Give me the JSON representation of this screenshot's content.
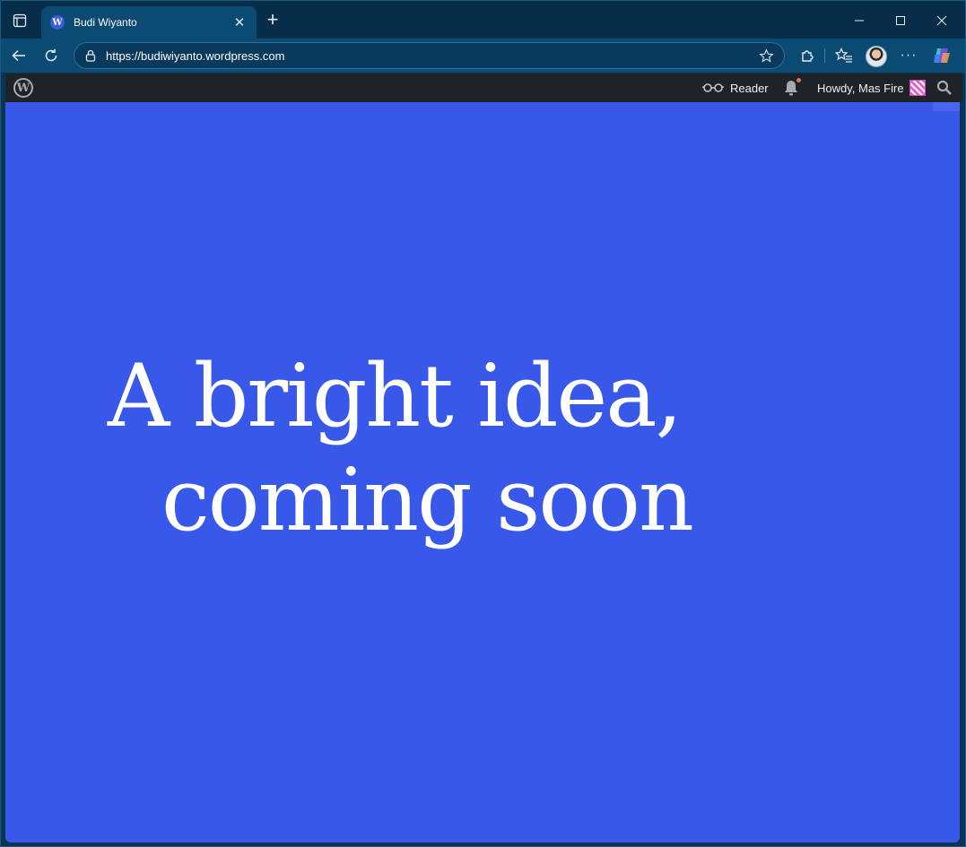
{
  "browser": {
    "tab": {
      "title": "Budi Wiyanto",
      "favicon": "wordpress-icon"
    },
    "address_bar": {
      "url": "https://budiwiyanto.wordpress.com"
    },
    "theme_color": "#0b4a73"
  },
  "admin_bar": {
    "reader_label": "Reader",
    "howdy_label": "Howdy, Mas Fire",
    "background": "#1d2327"
  },
  "page": {
    "headline_line1": "A bright idea,",
    "headline_line2": "coming soon",
    "background": "#3858e9",
    "text_color": "#ffffff"
  }
}
